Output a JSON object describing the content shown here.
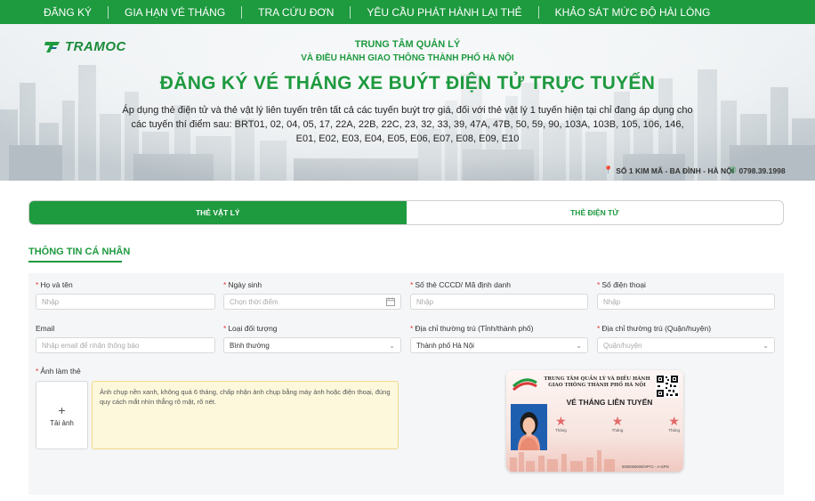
{
  "nav": {
    "items": [
      "ĐĂNG KÝ",
      "GIA HẠN VÉ THÁNG",
      "TRA CỨU ĐƠN",
      "YÊU CẦU PHÁT HÀNH LẠI THẺ",
      "KHẢO SÁT MỨC ĐỘ HÀI LÒNG"
    ]
  },
  "banner": {
    "logo_text": "TRAMOC",
    "org_line1": "TRUNG TÂM QUẢN LÝ",
    "org_line2": "VÀ ĐIỀU HÀNH GIAO THÔNG THÀNH PHỐ HÀ NỘI",
    "title": "ĐĂNG KÝ VÉ THÁNG XE BUÝT ĐIỆN TỬ TRỰC TUYẾN",
    "description": "Áp dụng thẻ điện tử và thẻ vật lý liên tuyến trên tất cả các tuyến buýt trợ giá, đối với thẻ vật lý 1 tuyến hiện tại chỉ đang áp dụng cho các tuyến thí điểm sau: BRT01, 02, 04, 05, 17, 22A, 22B, 22C, 23, 32, 33, 39, 47A, 47B, 50, 59, 90, 103A, 103B, 105, 106, 146, E01, E02, E03, E04, E05, E06, E07, E08, E09, E10",
    "address": "SỐ 1 KIM MÃ - BA ĐÌNH - HÀ NỘI",
    "phone": "0798.39.1998",
    "address_icon": "location-pin-icon",
    "phone_icon": "phone-icon"
  },
  "tabs": [
    {
      "label": "THẺ VẬT LÝ",
      "active": true
    },
    {
      "label": "THẺ ĐIỆN TỬ",
      "active": false
    }
  ],
  "section": {
    "title": "THÔNG TIN CÁ NHÂN"
  },
  "form": {
    "full_name": {
      "label": "Họ và tên",
      "required": true,
      "placeholder": "Nhập"
    },
    "dob": {
      "label": "Ngày sinh",
      "required": true,
      "placeholder": "Chọn thời điểm",
      "icon": "calendar-icon"
    },
    "id_number": {
      "label": "Số thẻ CCCD/ Mã định danh",
      "required": true,
      "placeholder": "Nhập"
    },
    "phone": {
      "label": "Số điện thoại",
      "required": true,
      "placeholder": "Nhập"
    },
    "email": {
      "label": "Email",
      "required": false,
      "placeholder": "Nhập email để nhận thông báo"
    },
    "subject_type": {
      "label": "Loại đối tượng",
      "required": true,
      "value": "Bình thường"
    },
    "province": {
      "label": "Địa chỉ thường trú (Tỉnh/thành phố)",
      "required": true,
      "value": "Thành phố Hà Nội"
    },
    "district": {
      "label": "Địa chỉ thường trú (Quận/huyện)",
      "required": true,
      "placeholder": "Quận/huyện"
    },
    "photo": {
      "label": "Ảnh làm thẻ",
      "required": true,
      "upload_plus": "+",
      "upload_label": "Tải ảnh",
      "note": "Ảnh chụp nền xanh, không quá 6 tháng, chấp nhận ảnh chụp bằng máy ảnh hoặc điện thoại, đúng quy cách mắt nhìn thẳng rõ mặt, rõ nét."
    }
  },
  "card": {
    "org": "TRUNG TÂM QUẢN LÝ VÀ ĐIỀU HÀNH GIAO THÔNG THÀNH PHỐ HÀ NỘI",
    "title": "VÉ THÁNG LIÊN TUYẾN",
    "star_label": "Tháng",
    "code": "0000000000/HPTC - A-GPN"
  },
  "colors": {
    "brand_green": "#1e9a3f",
    "required_red": "#e53935",
    "note_bg": "#fdf8dc"
  }
}
